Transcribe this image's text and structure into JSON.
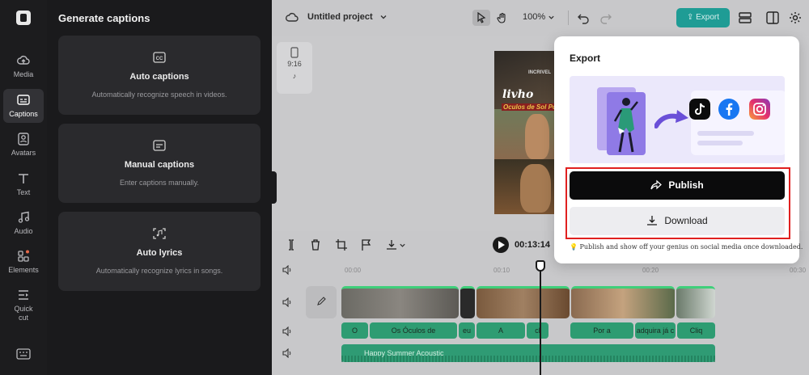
{
  "sidebar": {
    "items": [
      {
        "label": "Media",
        "icon": "cloud-upload-icon"
      },
      {
        "label": "Captions",
        "icon": "captions-icon",
        "active": true
      },
      {
        "label": "Avatars",
        "icon": "avatar-icon"
      },
      {
        "label": "Text",
        "icon": "text-icon"
      },
      {
        "label": "Audio",
        "icon": "music-note-icon"
      },
      {
        "label": "Elements",
        "icon": "elements-icon"
      },
      {
        "label": "Quick cut",
        "icon": "quick-cut-icon"
      }
    ]
  },
  "panel": {
    "title": "Generate captions",
    "cards": [
      {
        "title": "Auto captions",
        "desc": "Automatically recognize speech in videos.",
        "icon": "cc-icon"
      },
      {
        "title": "Manual captions",
        "desc": "Enter captions manually.",
        "icon": "subtitle-icon"
      },
      {
        "title": "Auto lyrics",
        "desc": "Automatically recognize lyrics in songs.",
        "icon": "lyrics-scan-icon"
      }
    ]
  },
  "topbar": {
    "project_title": "Untitled project",
    "zoom": "100%",
    "export_label": "Export"
  },
  "preview": {
    "ratio_label": "9:16",
    "video_text_top": "INCRIVEL",
    "video_text_main": "livho",
    "video_text_sub": "Oculos de Sol Polar"
  },
  "timeline": {
    "current_time": "00:13:14",
    "ruler": [
      "00:00",
      "00:10",
      "00:20",
      "00:30"
    ],
    "captions": [
      {
        "text": "O"
      },
      {
        "text": "Os Óculos de"
      },
      {
        "text": "eu"
      },
      {
        "text": "A"
      },
      {
        "text": "cl"
      },
      {
        "text": "Por a"
      },
      {
        "text": "adquira já c"
      },
      {
        "text": "Cliq"
      }
    ],
    "audio_label": "Happy Summer Acoustic"
  },
  "export_dialog": {
    "title": "Export",
    "publish_label": "Publish",
    "download_label": "Download",
    "tip": "Publish and show off your genius on social media once downloaded.",
    "colors": {
      "publish_bg": "#0b0b0c",
      "download_bg": "#ededf0",
      "highlight": "#e0201f"
    }
  }
}
